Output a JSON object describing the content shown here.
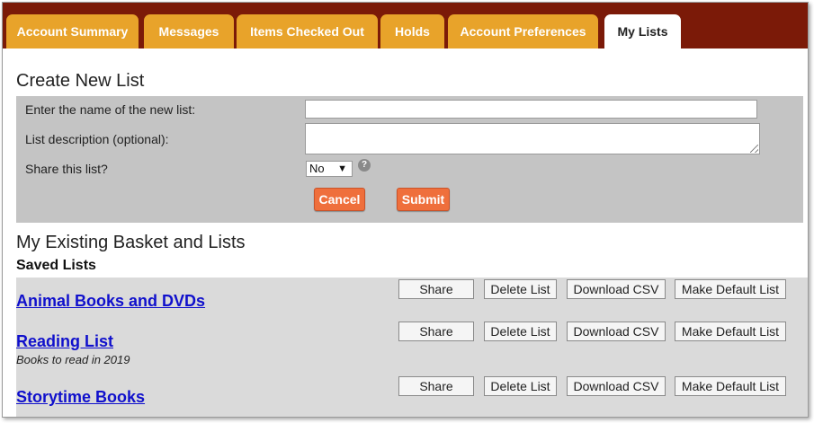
{
  "tabs": [
    {
      "label": "Account Summary"
    },
    {
      "label": "Messages"
    },
    {
      "label": "Items Checked Out"
    },
    {
      "label": "Holds"
    },
    {
      "label": "Account Preferences"
    },
    {
      "label": "My Lists",
      "active": true
    }
  ],
  "create_list": {
    "title": "Create New List",
    "name_label": "Enter the name of the new list:",
    "name_value": "",
    "description_label": "List description (optional):",
    "description_value": "",
    "share_label": "Share this list?",
    "share_value": "No",
    "help_icon": "question-icon",
    "cancel_label": "Cancel",
    "submit_label": "Submit"
  },
  "existing": {
    "title": "My Existing Basket and Lists",
    "saved_heading": "Saved Lists",
    "lists": [
      {
        "name": "Animal Books and DVDs",
        "description": ""
      },
      {
        "name": "Reading List",
        "description": "Books to read in 2019"
      },
      {
        "name": "Storytime Books",
        "description": ""
      }
    ],
    "actions": {
      "share": "Share",
      "delete": "Delete List",
      "download": "Download CSV",
      "default": "Make Default List"
    }
  },
  "colors": {
    "tab_bar": "#7b1a08",
    "tab": "#e8a32a",
    "orange_button": "#ef6f3c",
    "link": "#1010cc",
    "form_panel": "#c4c4c4",
    "list_panel": "#dadada"
  }
}
